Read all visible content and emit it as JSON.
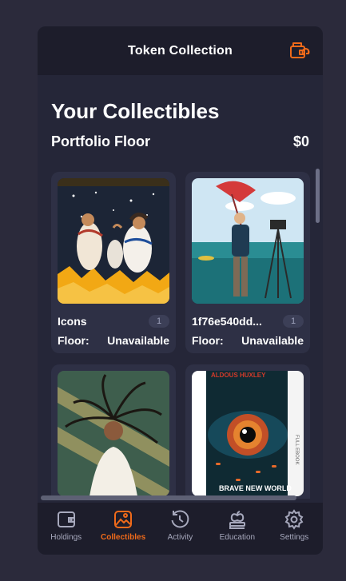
{
  "header": {
    "title": "Token Collection",
    "icon": "wallet-sync-icon"
  },
  "collectibles": {
    "title": "Your Collectibles",
    "portfolio_floor_label": "Portfolio Floor",
    "portfolio_floor_value": "$0",
    "cards": [
      {
        "name": "Icons",
        "count": "1",
        "floor_label": "Floor:",
        "floor_value": "Unavailable"
      },
      {
        "name": "1f76e540dd...",
        "count": "1",
        "floor_label": "Floor:",
        "floor_value": "Unavailable"
      },
      {
        "name": "",
        "count": "",
        "floor_label": "",
        "floor_value": ""
      },
      {
        "name": "",
        "count": "",
        "floor_label": "",
        "floor_value": ""
      }
    ],
    "book_author": "ALDOUS HUXLEY",
    "book_title": "BRAVE NEW WORLD",
    "book_spine": "FULL EBOOK"
  },
  "nav": {
    "items": [
      {
        "label": "Holdings",
        "icon": "wallet-icon"
      },
      {
        "label": "Collectibles",
        "icon": "image-icon"
      },
      {
        "label": "Activity",
        "icon": "history-icon"
      },
      {
        "label": "Education",
        "icon": "apple-books-icon"
      },
      {
        "label": "Settings",
        "icon": "gear-icon"
      }
    ],
    "active": "Collectibles"
  },
  "colors": {
    "accent": "#f06a1a",
    "background": "#2b2a3b",
    "panel": "#252638",
    "card": "#2e3045"
  }
}
